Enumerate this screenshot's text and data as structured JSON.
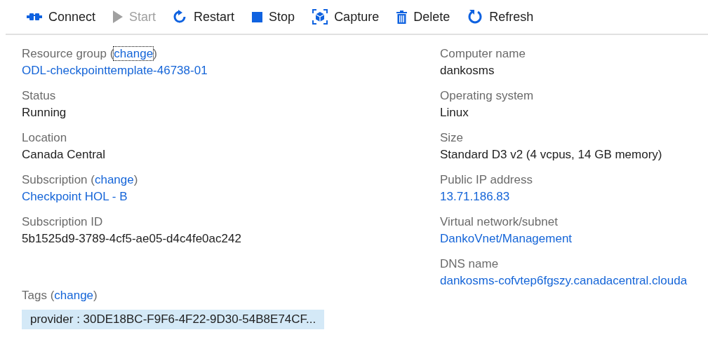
{
  "toolbar": [
    {
      "kind": "connect",
      "label": "Connect",
      "disabled": false
    },
    {
      "kind": "start",
      "label": "Start",
      "disabled": true
    },
    {
      "kind": "restart",
      "label": "Restart",
      "disabled": false
    },
    {
      "kind": "stop",
      "label": "Stop",
      "disabled": false
    },
    {
      "kind": "capture",
      "label": "Capture",
      "disabled": false
    },
    {
      "kind": "delete",
      "label": "Delete",
      "disabled": false
    },
    {
      "kind": "refresh",
      "label": "Refresh",
      "disabled": false
    }
  ],
  "left_fields": [
    {
      "label": "Resource group (",
      "link": "change",
      "link_focused": true,
      "label_end": ")",
      "value": "ODL-checkpointtemplate-46738-01",
      "kind": "link"
    },
    {
      "label": "Status",
      "value": "Running",
      "kind": "text"
    },
    {
      "label": "Location",
      "value": "Canada Central",
      "kind": "text"
    },
    {
      "label": "Subscription (",
      "link": "change",
      "link_focused": false,
      "label_end": ")",
      "value": "Checkpoint HOL - B",
      "kind": "link"
    },
    {
      "label": "Subscription ID",
      "value": "5b1525d9-3789-4cf5-ae05-d4c4fe0ac242",
      "kind": "text"
    }
  ],
  "right_fields": [
    {
      "label": "Computer name",
      "value": "dankosms",
      "kind": "text"
    },
    {
      "label": "Operating system",
      "value": "Linux",
      "kind": "text"
    },
    {
      "label": "Size",
      "value": "Standard D3 v2 (4 vcpus, 14 GB memory)",
      "kind": "text"
    },
    {
      "label": "Public IP address",
      "value": "13.71.186.83",
      "kind": "link"
    },
    {
      "label": "Virtual network/subnet",
      "value": "DankoVnet/Management",
      "kind": "link"
    },
    {
      "label": "DNS name",
      "value": "dankosms-cofvtep6fgszy.canadacentral.clouda",
      "kind": "link"
    }
  ],
  "tags": {
    "label": "Tags (",
    "link": "change",
    "label_end": ")",
    "items": [
      "provider : 30DE18BC-F9F6-4F22-9D30-54B8E74CF..."
    ]
  }
}
